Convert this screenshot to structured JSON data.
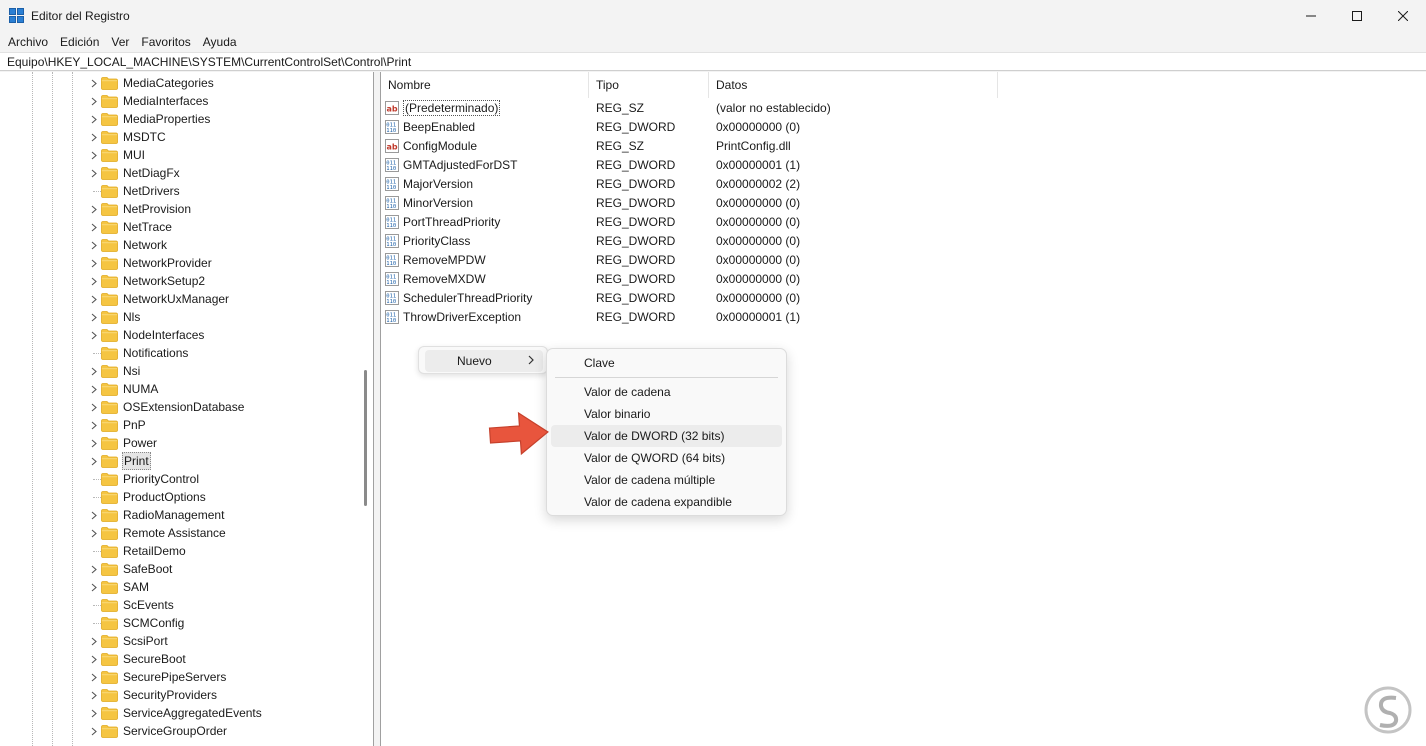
{
  "window": {
    "title": "Editor del Registro",
    "icon": "registry-icon"
  },
  "menu": [
    "Archivo",
    "Edición",
    "Ver",
    "Favoritos",
    "Ayuda"
  ],
  "address": "Equipo\\HKEY_LOCAL_MACHINE\\SYSTEM\\CurrentControlSet\\Control\\Print",
  "tree": [
    {
      "label": "MediaCategories",
      "expandable": true
    },
    {
      "label": "MediaInterfaces",
      "expandable": true
    },
    {
      "label": "MediaProperties",
      "expandable": true
    },
    {
      "label": "MSDTC",
      "expandable": true
    },
    {
      "label": "MUI",
      "expandable": true
    },
    {
      "label": "NetDiagFx",
      "expandable": true
    },
    {
      "label": "NetDrivers",
      "expandable": false
    },
    {
      "label": "NetProvision",
      "expandable": true
    },
    {
      "label": "NetTrace",
      "expandable": true
    },
    {
      "label": "Network",
      "expandable": true
    },
    {
      "label": "NetworkProvider",
      "expandable": true
    },
    {
      "label": "NetworkSetup2",
      "expandable": true
    },
    {
      "label": "NetworkUxManager",
      "expandable": true
    },
    {
      "label": "Nls",
      "expandable": true
    },
    {
      "label": "NodeInterfaces",
      "expandable": true
    },
    {
      "label": "Notifications",
      "expandable": false
    },
    {
      "label": "Nsi",
      "expandable": true
    },
    {
      "label": "NUMA",
      "expandable": true
    },
    {
      "label": "OSExtensionDatabase",
      "expandable": true
    },
    {
      "label": "PnP",
      "expandable": true
    },
    {
      "label": "Power",
      "expandable": true
    },
    {
      "label": "Print",
      "expandable": true,
      "selected": true
    },
    {
      "label": "PriorityControl",
      "expandable": false
    },
    {
      "label": "ProductOptions",
      "expandable": false
    },
    {
      "label": "RadioManagement",
      "expandable": true
    },
    {
      "label": "Remote Assistance",
      "expandable": true
    },
    {
      "label": "RetailDemo",
      "expandable": false
    },
    {
      "label": "SafeBoot",
      "expandable": true
    },
    {
      "label": "SAM",
      "expandable": true
    },
    {
      "label": "ScEvents",
      "expandable": false
    },
    {
      "label": "SCMConfig",
      "expandable": false
    },
    {
      "label": "ScsiPort",
      "expandable": true
    },
    {
      "label": "SecureBoot",
      "expandable": true
    },
    {
      "label": "SecurePipeServers",
      "expandable": true
    },
    {
      "label": "SecurityProviders",
      "expandable": true
    },
    {
      "label": "ServiceAggregatedEvents",
      "expandable": true
    },
    {
      "label": "ServiceGroupOrder",
      "expandable": true
    }
  ],
  "list": {
    "columns": [
      "Nombre",
      "Tipo",
      "Datos"
    ],
    "rows": [
      {
        "name": "(Predeterminado)",
        "type": "REG_SZ",
        "data": "(valor no establecido)",
        "icon": "string-value-icon"
      },
      {
        "name": "BeepEnabled",
        "type": "REG_DWORD",
        "data": "0x00000000 (0)",
        "icon": "binary-value-icon"
      },
      {
        "name": "ConfigModule",
        "type": "REG_SZ",
        "data": "PrintConfig.dll",
        "icon": "string-value-icon"
      },
      {
        "name": "GMTAdjustedForDST",
        "type": "REG_DWORD",
        "data": "0x00000001 (1)",
        "icon": "binary-value-icon"
      },
      {
        "name": "MajorVersion",
        "type": "REG_DWORD",
        "data": "0x00000002 (2)",
        "icon": "binary-value-icon"
      },
      {
        "name": "MinorVersion",
        "type": "REG_DWORD",
        "data": "0x00000000 (0)",
        "icon": "binary-value-icon"
      },
      {
        "name": "PortThreadPriority",
        "type": "REG_DWORD",
        "data": "0x00000000 (0)",
        "icon": "binary-value-icon"
      },
      {
        "name": "PriorityClass",
        "type": "REG_DWORD",
        "data": "0x00000000 (0)",
        "icon": "binary-value-icon"
      },
      {
        "name": "RemoveMPDW",
        "type": "REG_DWORD",
        "data": "0x00000000 (0)",
        "icon": "binary-value-icon"
      },
      {
        "name": "RemoveMXDW",
        "type": "REG_DWORD",
        "data": "0x00000000 (0)",
        "icon": "binary-value-icon"
      },
      {
        "name": "SchedulerThreadPriority",
        "type": "REG_DWORD",
        "data": "0x00000000 (0)",
        "icon": "binary-value-icon"
      },
      {
        "name": "ThrowDriverException",
        "type": "REG_DWORD",
        "data": "0x00000001 (1)",
        "icon": "binary-value-icon"
      }
    ]
  },
  "context_menu": {
    "parent": "Nuevo",
    "items": [
      {
        "label": "Clave"
      },
      {
        "label": "Valor de cadena"
      },
      {
        "label": "Valor binario"
      },
      {
        "label": "Valor de DWORD (32 bits)",
        "highlighted": true
      },
      {
        "label": "Valor de QWORD (64 bits)"
      },
      {
        "label": "Valor de cadena múltiple"
      },
      {
        "label": "Valor de cadena expandible"
      }
    ]
  },
  "colors": {
    "folder": "#f5c542",
    "folder_dark": "#e0a91e",
    "annotation_arrow": "#e8553d",
    "accent_blue": "#2a7fd4"
  }
}
